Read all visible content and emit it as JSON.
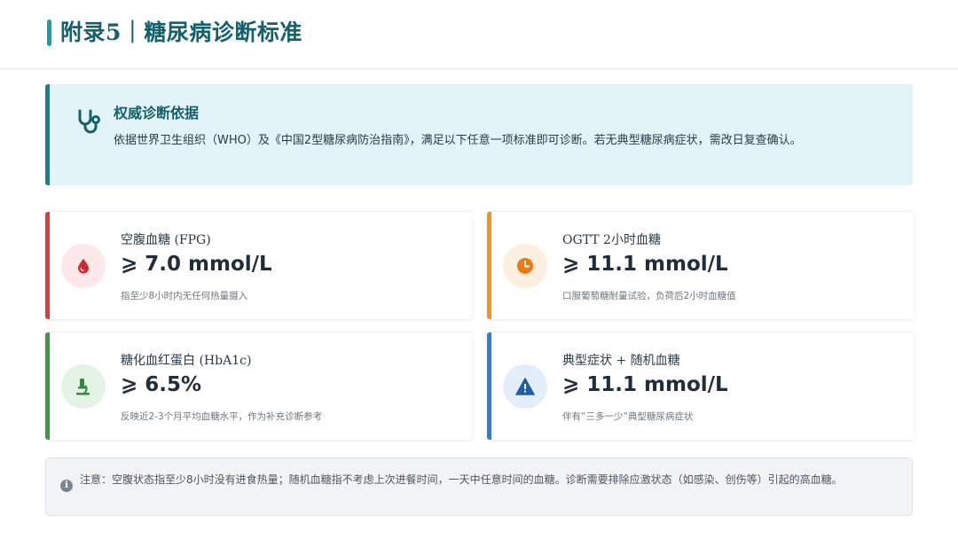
{
  "header": {
    "title": "附录5｜糖尿病诊断标准"
  },
  "basis": {
    "icon": "stethoscope-icon",
    "title": "权威诊断依据",
    "description": "依据世界卫生组织（WHO）及《中国2型糖尿病防治指南》，满足以下任意一项标准即可诊断。若无典型糖尿病症状，需改日复查确认。"
  },
  "criteria": [
    {
      "label": "空腹血糖 (FPG)",
      "value": "⩾ 7.0 mmol/L",
      "note": "指至少8小时内无任何热量摄入",
      "icon": "blood-drop-icon",
      "accent": "#e03a3e",
      "icon_bg": "#fde8e9"
    },
    {
      "label": "OGTT 2小时血糖",
      "value": "⩾ 11.1 mmol/L",
      "note": "口服葡萄糖耐量试验，负荷后2小时血糖值",
      "icon": "clock-icon",
      "accent": "#f5931e",
      "icon_bg": "#fdefe0"
    },
    {
      "label": "糖化血红蛋白 (HbA1c)",
      "value": "⩾ 6.5%",
      "note": "反映近2-3个月平均血糖水平，作为补充诊断参考",
      "icon": "microscope-icon",
      "accent": "#3a9a48",
      "icon_bg": "#e4f3e6"
    },
    {
      "label": "典型症状 + 随机血糖",
      "value": "⩾ 11.1 mmol/L",
      "note": "伴有“三多一少”典型糖尿病症状",
      "icon": "warning-icon",
      "accent": "#2f7fd6",
      "icon_bg": "#e3eefb"
    }
  ],
  "footnote": {
    "icon": "info-icon",
    "text": "注意：空腹状态指至少8小时没有进食热量；随机血糖指不考虑上次进餐时间，一天中任意时间的血糖。诊断需要排除应激状态（如感染、创伤等）引起的高血糖。"
  }
}
